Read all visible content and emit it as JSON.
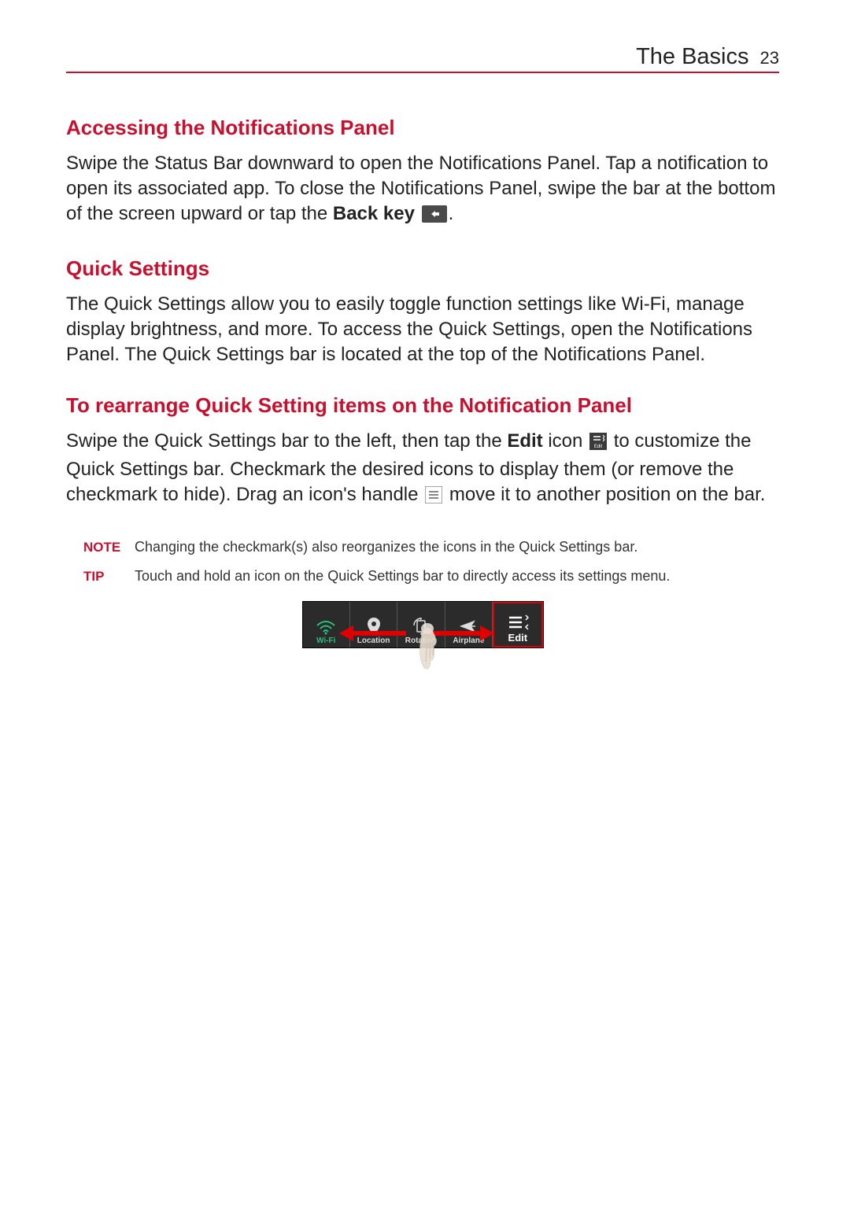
{
  "header": {
    "title": "The Basics",
    "page_number": "23"
  },
  "section1": {
    "heading": "Accessing the Notifications Panel",
    "p1a": "Swipe the Status Bar downward to open the Notifications Panel. Tap a notification to open its associated app. To close the Notifications Panel, swipe the bar at the bottom of the screen upward or tap the ",
    "back_key_label": "Back key",
    "p1b": "."
  },
  "section2": {
    "heading": "Quick Settings",
    "p1": "The Quick Settings allow you to easily toggle function settings like Wi-Fi, manage display brightness, and more. To access the Quick Settings, open the Notifications Panel. The Quick Settings bar is located at the top of the Notifications Panel."
  },
  "section3": {
    "heading": "To rearrange Quick Setting items on the Notification Panel",
    "p1a": "Swipe the Quick Settings bar to the left, then tap the ",
    "edit_label": "Edit",
    "p1b": " icon ",
    "p1c": " to customize the Quick Settings bar. Checkmark the desired icons to display them (or remove the checkmark to hide). Drag an icon's handle ",
    "p1d": " move it to another position on the bar."
  },
  "note": {
    "label": "NOTE",
    "text": "Changing the checkmark(s) also reorganizes the icons in the Quick Settings bar."
  },
  "tip": {
    "label": "TIP",
    "text": "Touch and hold an icon on the Quick Settings bar to directly access its settings menu."
  },
  "quick_settings_bar": {
    "items": [
      {
        "id": "wifi",
        "label": "Wi-Fi"
      },
      {
        "id": "location",
        "label": "Location"
      },
      {
        "id": "rotation",
        "label": "Rotation"
      },
      {
        "id": "airplane",
        "label": "Airplane"
      },
      {
        "id": "edit",
        "label": "Edit"
      }
    ]
  }
}
